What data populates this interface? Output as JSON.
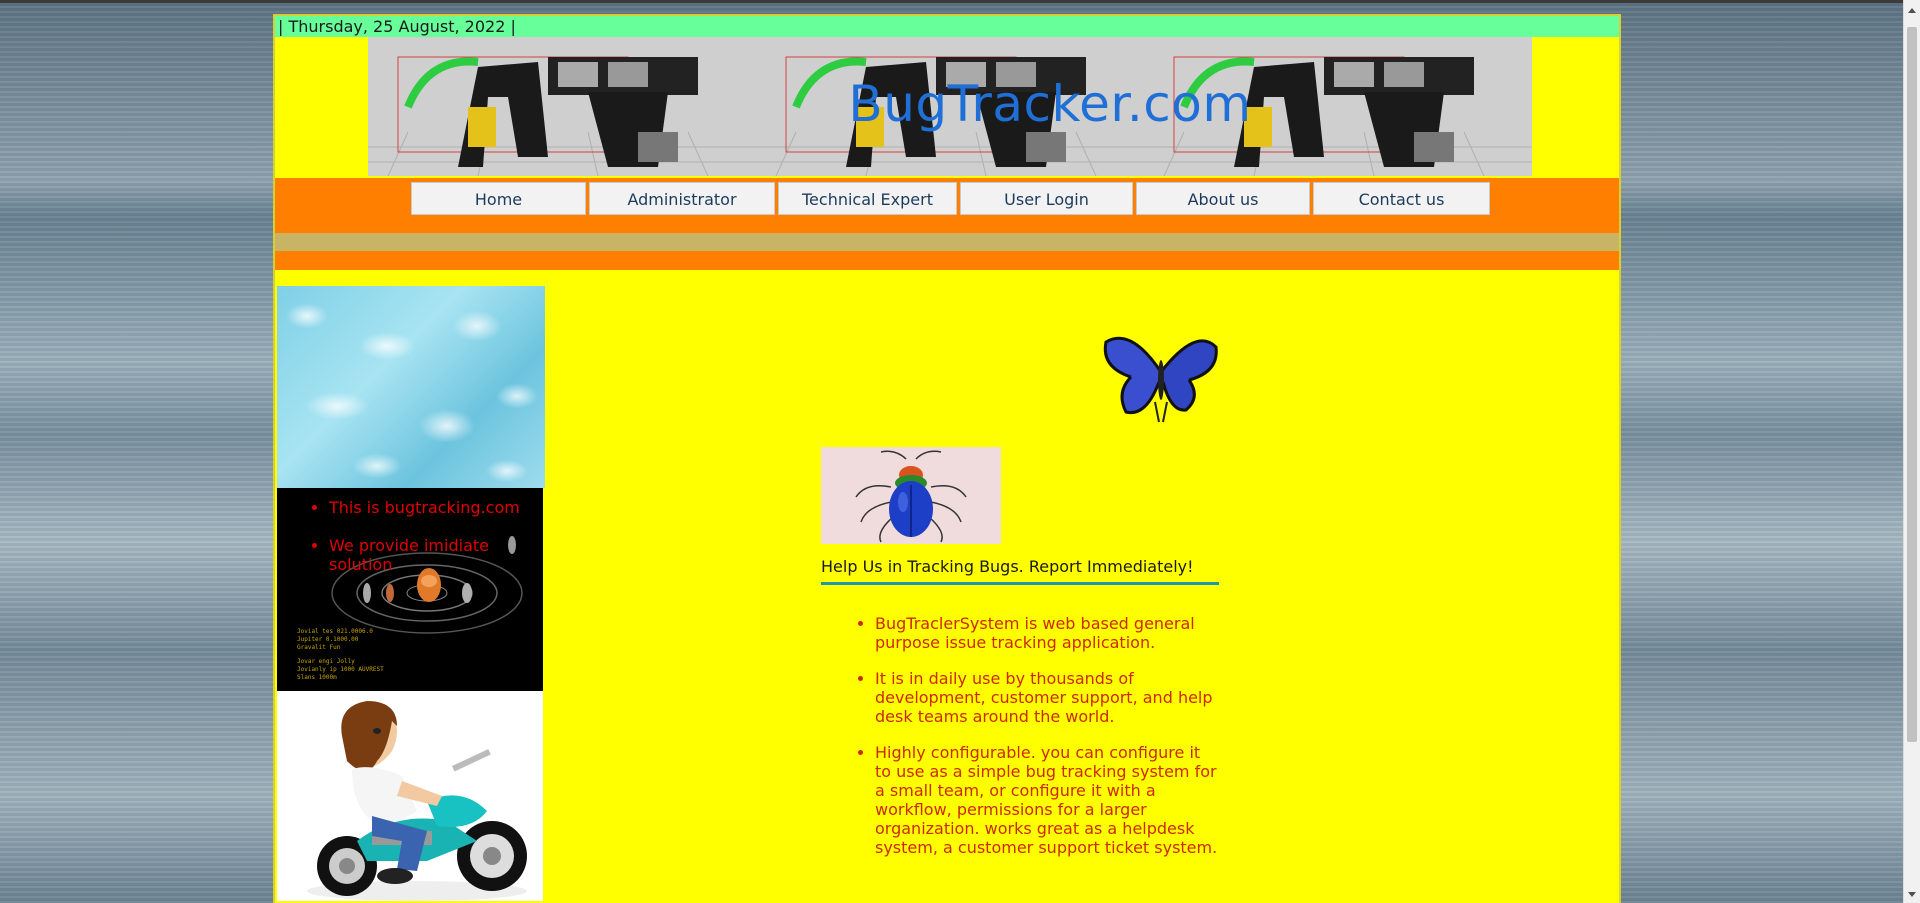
{
  "header": {
    "date_text": "| Thursday, 25 August, 2022 |",
    "site_title": "BugTracker.com"
  },
  "nav": {
    "items": [
      {
        "label": "Home"
      },
      {
        "label": "Administrator"
      },
      {
        "label": "Technical Expert"
      },
      {
        "label": "User Login"
      },
      {
        "label": "About us"
      },
      {
        "label": "Contact us"
      }
    ]
  },
  "sidebar": {
    "bullets": [
      "This is bugtracking.com",
      "We provide imidiate solution"
    ]
  },
  "main": {
    "help_heading": "Help Us in Tracking Bugs. Report Immediately!",
    "features": [
      "BugTraclerSystem is web based general purpose issue tracking application.",
      "It is in daily use by thousands of development, customer support, and help desk teams around the world.",
      "Highly configurable. you can configure it to use as a simple bug tracking system for a small team, or configure it with a workflow, permissions for a larger organization. works great as a helpdesk system, a customer support ticket system."
    ]
  },
  "colors": {
    "page_bg": "#ffff00",
    "date_bar": "#66ff99",
    "nav_band": "#ff8000",
    "nav_strip": "#c8b464",
    "title_blue": "#1f6fd6",
    "list_red": "#cc2a00",
    "heading_rule": "#2196a8"
  }
}
